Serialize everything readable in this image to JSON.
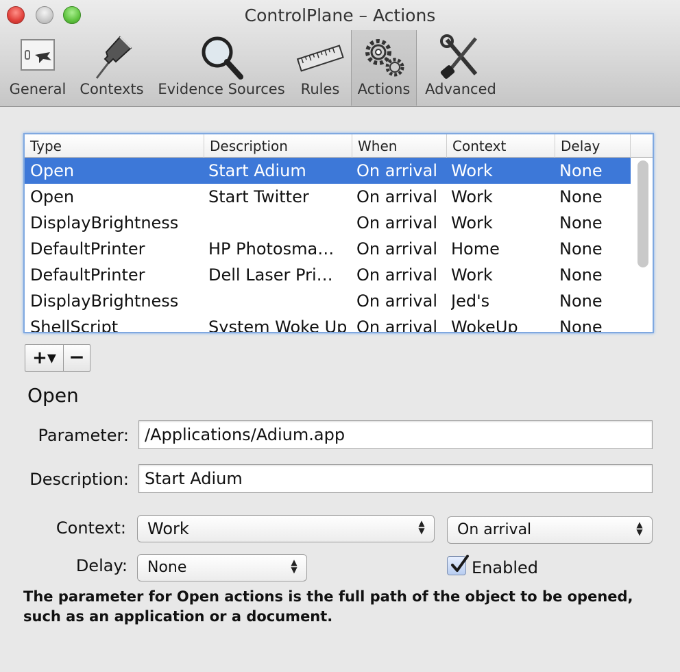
{
  "window": {
    "title": "ControlPlane – Actions"
  },
  "toolbar": {
    "items": [
      {
        "label": "General",
        "icon": "general-icon"
      },
      {
        "label": "Contexts",
        "icon": "pushpin-icon"
      },
      {
        "label": "Evidence Sources",
        "icon": "magnifier-icon"
      },
      {
        "label": "Rules",
        "icon": "ruler-icon"
      },
      {
        "label": "Actions",
        "icon": "gears-icon",
        "selected": true
      },
      {
        "label": "Advanced",
        "icon": "tools-icon"
      }
    ]
  },
  "table": {
    "columns": [
      "Type",
      "Description",
      "When",
      "Context",
      "Delay"
    ],
    "rows": [
      [
        "Open",
        "Start Adium",
        "On arrival",
        "Work",
        "None"
      ],
      [
        "Open",
        "Start Twitter",
        "On arrival",
        "Work",
        "None"
      ],
      [
        "DisplayBrightness",
        "",
        "On arrival",
        "Work",
        "None"
      ],
      [
        "DefaultPrinter",
        "HP Photosma…",
        "On arrival",
        "Home",
        "None"
      ],
      [
        "DefaultPrinter",
        "Dell Laser Pri…",
        "On arrival",
        "Work",
        "None"
      ],
      [
        "DisplayBrightness",
        "",
        "On arrival",
        "Jed's",
        "None"
      ],
      [
        "ShellScript",
        "System Woke Up",
        "On arrival",
        "WokeUp",
        "None"
      ]
    ],
    "selected_row": 0
  },
  "controls": {
    "add_label": "+▾",
    "remove_label": "−"
  },
  "detail": {
    "title": "Open",
    "parameter_label": "Parameter:",
    "parameter_value": "/Applications/Adium.app",
    "description_label": "Description:",
    "description_value": "Start Adium",
    "context_label": "Context:",
    "context_value": "Work",
    "when_value": "On arrival",
    "delay_label": "Delay:",
    "delay_value": "None",
    "enabled_label": "Enabled",
    "enabled": true,
    "help_text": "The parameter for Open actions is the full path of the object to be opened, such as an application or a document."
  },
  "colors": {
    "selection": "#3d78d8",
    "focus_ring": "#7fa8e0"
  }
}
